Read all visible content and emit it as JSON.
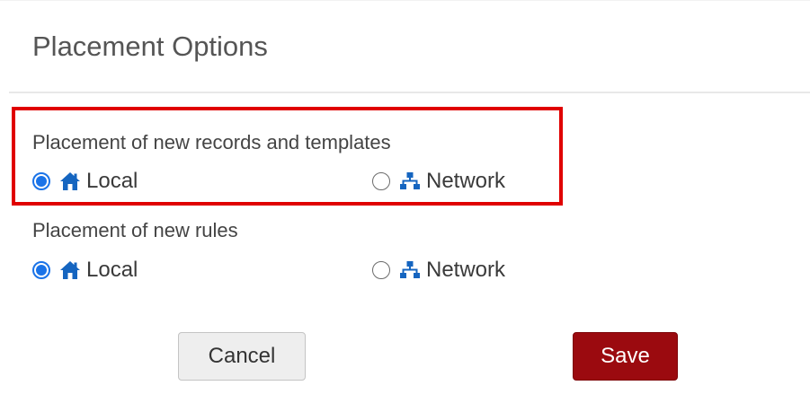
{
  "dialog": {
    "title": "Placement Options"
  },
  "groups": [
    {
      "label": "Placement of new records and templates",
      "options": [
        {
          "label": "Local",
          "icon": "home-icon",
          "checked": true
        },
        {
          "label": "Network",
          "icon": "sitemap-icon",
          "checked": false
        }
      ]
    },
    {
      "label": "Placement of new rules",
      "options": [
        {
          "label": "Local",
          "icon": "home-icon",
          "checked": true
        },
        {
          "label": "Network",
          "icon": "sitemap-icon",
          "checked": false
        }
      ]
    }
  ],
  "buttons": {
    "cancel_label": "Cancel",
    "save_label": "Save"
  },
  "colors": {
    "accent": "#1a73e8",
    "icon": "#1565c0",
    "save_button": "#9b0a0f",
    "highlight_border": "#e00000"
  }
}
